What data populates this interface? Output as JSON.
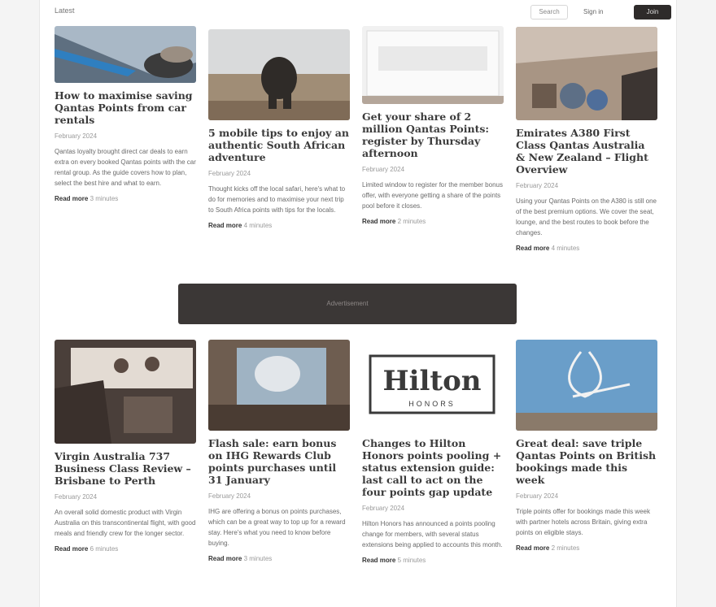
{
  "topbar": {
    "left_label": "Latest",
    "outline_button": "Search",
    "link": "Sign in",
    "dark_button": "Join"
  },
  "ad": {
    "label": "Advertisement"
  },
  "cards": [
    {
      "title": "How to maximise saving Qantas Points from car rentals",
      "date": "February 2024",
      "excerpt": "Qantas loyalty brought direct car deals to earn extra on every booked Qantas points with the car rental group. As the guide covers how to plan, select the best hire and what to earn.",
      "more": "Read more",
      "mins": "3 minutes"
    },
    {
      "title": "5 mobile tips to enjoy an authentic South African adventure",
      "date": "February 2024",
      "excerpt": "Thought kicks off the local safari, here's what to do for memories and to maximise your next trip to South Africa points with tips for the locals.",
      "more": "Read more",
      "mins": "4 minutes"
    },
    {
      "title": "Get your share of 2 million Qantas Points: register by Thursday afternoon",
      "date": "February 2024",
      "excerpt": "Limited window to register for the member bonus offer, with everyone getting a share of the points pool before it closes.",
      "more": "Read more",
      "mins": "2 minutes"
    },
    {
      "title": "Emirates A380 First Class Qantas Australia & New Zealand – Flight Overview",
      "date": "February 2024",
      "excerpt": "Using your Qantas Points on the A380 is still one of the best premium options. We cover the seat, lounge, and the best routes to book before the changes.",
      "more": "Read more",
      "mins": "4 minutes"
    },
    {
      "title": "Virgin Australia 737 Business Class Review – Brisbane to Perth",
      "date": "February 2024",
      "excerpt": "An overall solid domestic product with Virgin Australia on this transcontinental flight, with good meals and friendly crew for the longer sector.",
      "more": "Read more",
      "mins": "6 minutes"
    },
    {
      "title": "Flash sale: earn bonus on IHG Rewards Club points purchases until 31 January",
      "date": "February 2024",
      "excerpt": "IHG are offering a bonus on points purchases, which can be a great way to top up for a reward stay. Here's what you need to know before buying.",
      "more": "Read more",
      "mins": "3 minutes"
    },
    {
      "title": "Changes to Hilton Honors points pooling + status extension guide: last call to act on the four points gap update",
      "date": "February 2024",
      "excerpt": "Hilton Honors has announced a points pooling change for members, with several status extensions being applied to accounts this month.",
      "more": "Read more",
      "mins": "5 minutes"
    },
    {
      "title": "Great deal: save triple Qantas Points on British bookings made this week",
      "date": "February 2024",
      "excerpt": "Triple points offer for bookings made this week with partner hotels across Britain, giving extra points on eligible stays.",
      "more": "Read more",
      "mins": "2 minutes"
    }
  ],
  "hilton_logo": {
    "word": "Hilton",
    "sub": "HONORS"
  },
  "colors": {
    "dark": "#2e2b2a",
    "accent_sky": "#6a9ec9"
  }
}
